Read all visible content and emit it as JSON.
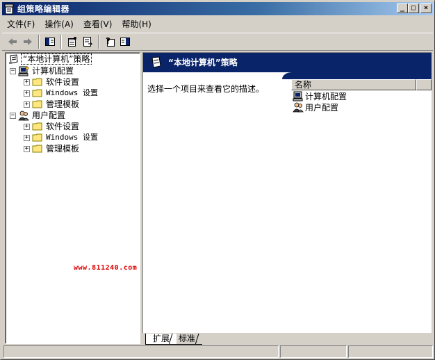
{
  "window": {
    "title": "组策略编辑器",
    "buttons": {
      "minimize": "_",
      "maximize": "□",
      "close": "×"
    }
  },
  "menu": [
    {
      "label": "文件(F)"
    },
    {
      "label": "操作(A)"
    },
    {
      "label": "查看(V)"
    },
    {
      "label": "帮助(H)"
    }
  ],
  "toolbar": {
    "icons": [
      "back-arrow-icon",
      "forward-arrow-icon",
      "show-hide-tree-icon",
      "properties-icon",
      "export-list-icon",
      "help-icon",
      "show-hide-action-pane-icon"
    ]
  },
  "tree": {
    "root": "“本地计算机”策略",
    "computer_config": "计算机配置",
    "user_config": "用户配置",
    "software_settings": "软件设置",
    "windows_settings": "Windows 设置",
    "admin_templates": "管理模板",
    "expander_collapsed": "+",
    "expander_expanded": "−"
  },
  "watermark": "www.811240.com",
  "detail": {
    "banner_title": "“本地计算机”策略",
    "description": "选择一个项目来查看它的描述。",
    "column_name": "名称",
    "items": [
      {
        "label": "计算机配置"
      },
      {
        "label": "用户配置"
      }
    ]
  },
  "tabs": {
    "extended": "扩展",
    "standard": "标准"
  },
  "colors": {
    "banner": "#0a246a",
    "titlebar_start": "#0a246a",
    "titlebar_end": "#a6caf0",
    "folder": "#ffe680",
    "watermark": "#e00000"
  }
}
